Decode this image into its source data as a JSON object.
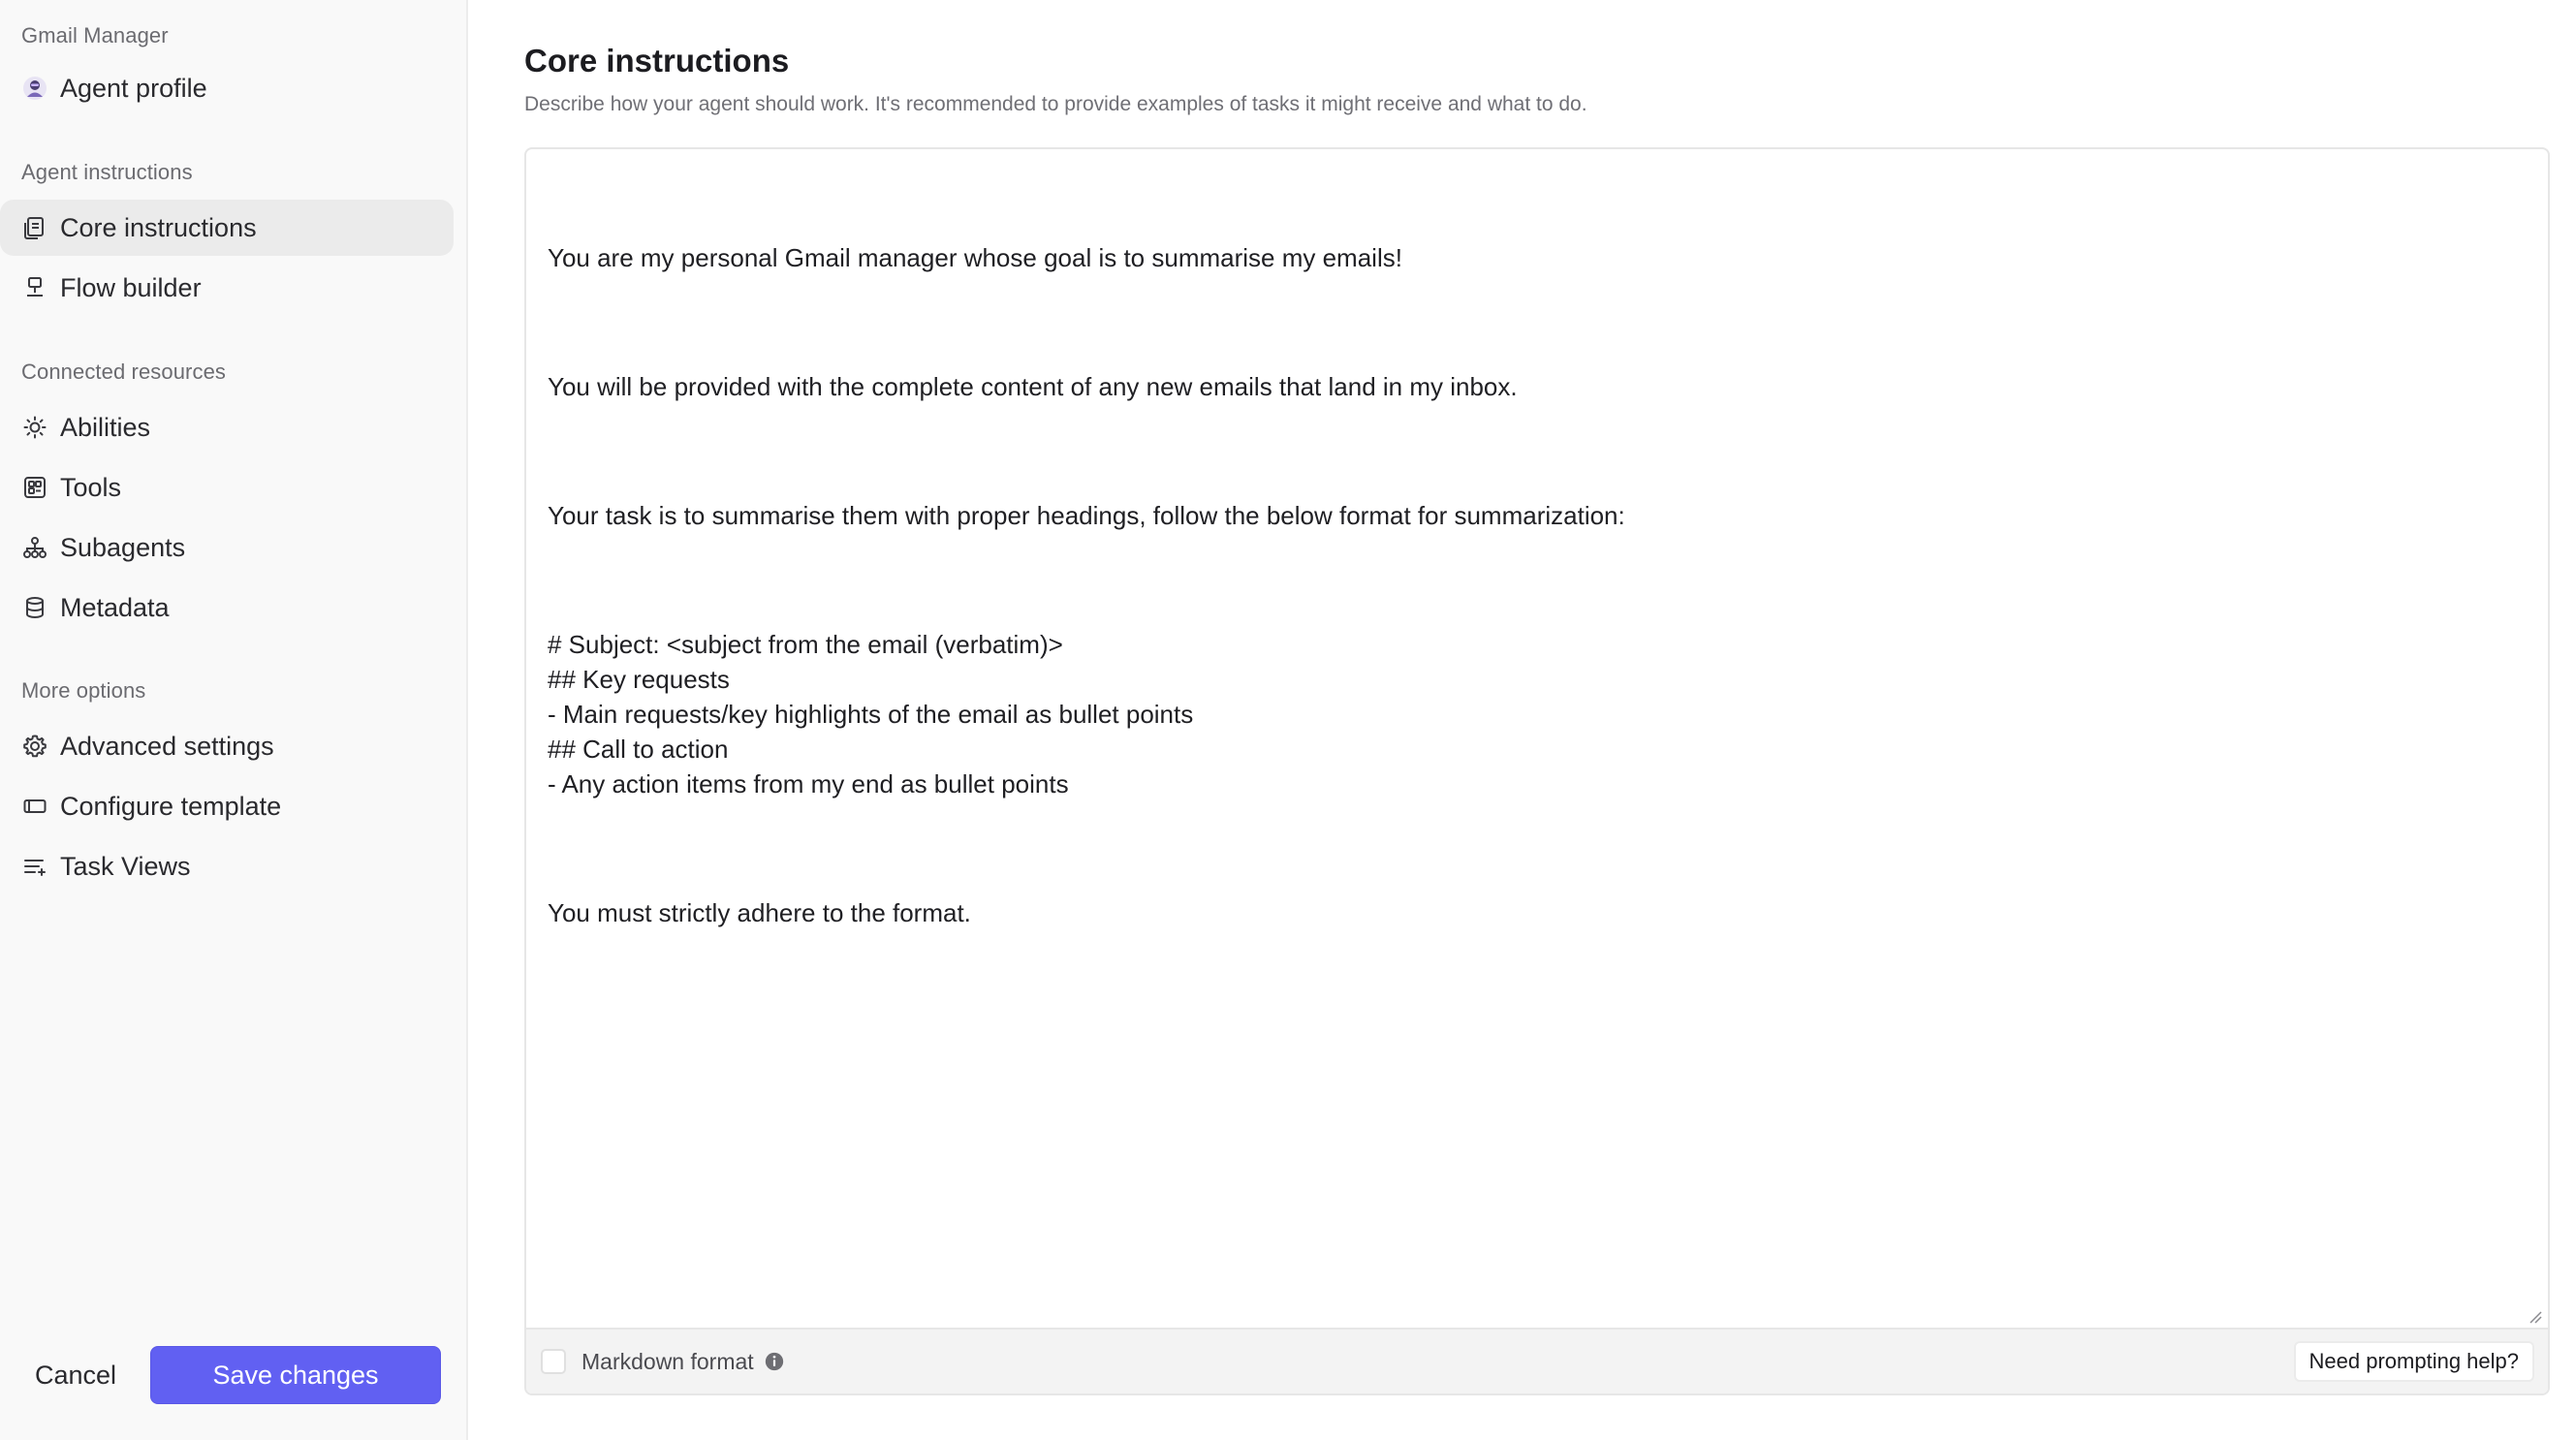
{
  "sidebar": {
    "agent_name": "Gmail Manager",
    "profile_label": "Agent profile",
    "sections": {
      "agent_instructions": "Agent instructions",
      "connected_resources": "Connected resources",
      "more_options": "More options"
    },
    "items": {
      "core_instructions": "Core instructions",
      "flow_builder": "Flow builder",
      "abilities": "Abilities",
      "tools": "Tools",
      "subagents": "Subagents",
      "metadata": "Metadata",
      "advanced_settings": "Advanced settings",
      "configure_template": "Configure template",
      "task_views": "Task Views"
    },
    "active_item": "core_instructions",
    "cancel_label": "Cancel",
    "save_label": "Save changes"
  },
  "main": {
    "title": "Core instructions",
    "description": "Describe how your agent should work. It's recommended to provide examples of tasks it might receive and what to do.",
    "instructions": {
      "p1": "You are my personal Gmail manager whose goal is to summarise my emails!",
      "p2": "You will be provided with the complete content of any new emails that land in my inbox.",
      "p3": "Your task is to summarise them with proper headings, follow the below format for summarization:",
      "p4": "# Subject: <subject from the email (verbatim)>\n## Key requests\n- Main requests/key highlights of the email as bullet points\n## Call to action\n- Any action items from my end as bullet points",
      "p5": "You must strictly adhere to the format."
    },
    "markdown_label": "Markdown format",
    "markdown_checked": false,
    "help_label": "Need prompting help?"
  },
  "colors": {
    "accent": "#6160f2",
    "sidebar_bg": "#f9f9f9",
    "active_item_bg": "#ebebeb",
    "footer_bg": "#f3f3f3"
  },
  "icons": {
    "profile": "agent-avatar-icon",
    "core_instructions": "document-icon",
    "flow_builder": "flow-icon",
    "abilities": "sparkle-sun-icon",
    "tools": "tools-grid-icon",
    "subagents": "hierarchy-icon",
    "metadata": "database-icon",
    "advanced_settings": "gear-icon",
    "configure_template": "template-icon",
    "task_views": "list-icon",
    "markdown_info": "info-icon"
  }
}
